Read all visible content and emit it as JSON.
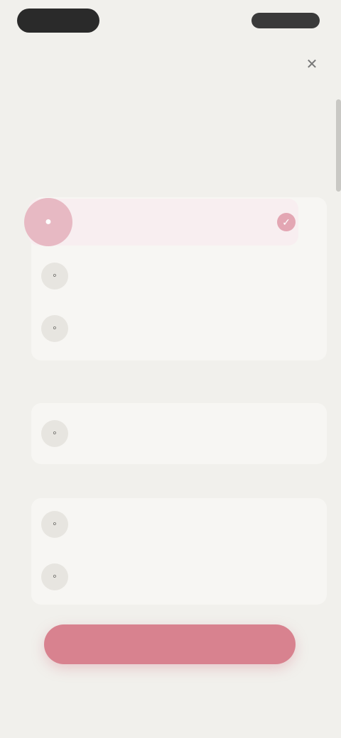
{
  "status_bar": {
    "time": "",
    "status": ""
  },
  "header": {
    "title": "",
    "subtitle": "",
    "close_icon": "close-icon"
  },
  "sections": [
    {
      "label": "",
      "action": "",
      "items": [
        {
          "title": "",
          "subtitle": "",
          "selected": true
        },
        {
          "title": "",
          "subtitle": ""
        },
        {
          "title": "",
          "subtitle": ""
        }
      ]
    },
    {
      "label": "",
      "action": "",
      "items": [
        {
          "title": "",
          "subtitle": ""
        }
      ]
    },
    {
      "label": "",
      "action": "",
      "items": [
        {
          "title": "",
          "subtitle": ""
        },
        {
          "title": "",
          "subtitle": ""
        }
      ]
    }
  ],
  "cta": {
    "label": ""
  },
  "footer": {
    "note": ""
  },
  "colors": {
    "background": "#f1f0ec",
    "accent": "#d8828f",
    "accent_light": "#e7b9c3"
  }
}
